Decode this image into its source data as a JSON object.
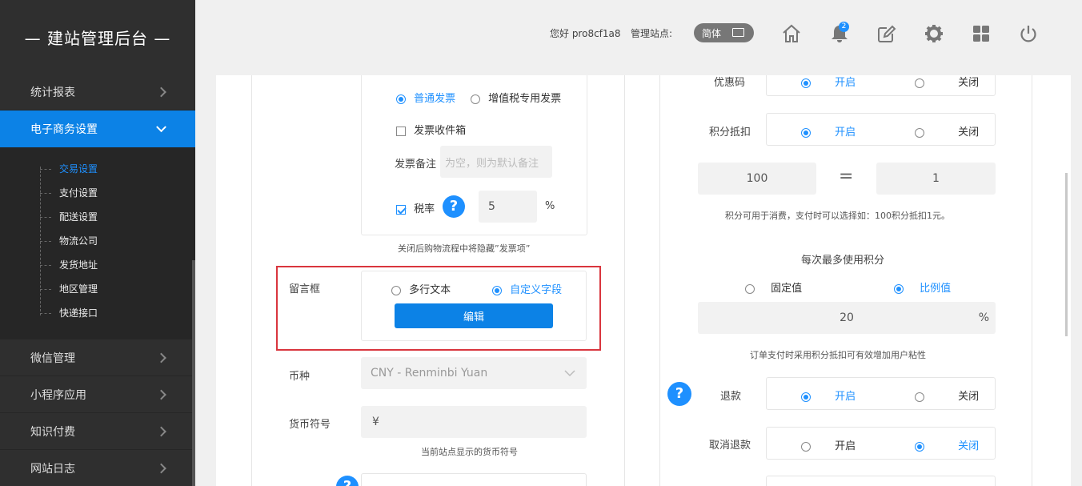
{
  "sidebar": {
    "title": "— 建站管理后台 —",
    "items": [
      {
        "label": "统计报表"
      },
      {
        "label": "电子商务设置"
      },
      {
        "label": "微信管理"
      },
      {
        "label": "小程序应用"
      },
      {
        "label": "知识付费"
      },
      {
        "label": "网站日志"
      }
    ],
    "sub_items": [
      "交易设置",
      "支付设置",
      "配送设置",
      "物流公司",
      "发货地址",
      "地区管理",
      "快递接口"
    ]
  },
  "header": {
    "greeting": "您好 pro8cf1a8",
    "site_label": "管理站点:",
    "lang": "简体",
    "notification_count": "2",
    "icons": [
      "home-icon",
      "bell-icon",
      "edit-icon",
      "gear-icon",
      "apps-icon",
      "power-icon"
    ]
  },
  "left": {
    "invoice": {
      "type_normal": "普通发票",
      "type_vat": "增值税专用发票",
      "inbox_label": "发票收件箱",
      "note_label": "发票备注",
      "note_placeholder": "为空，则为默认备注",
      "tax_label": "税率",
      "tax_value": "5",
      "tax_unit": "%",
      "hint": "关闭后购物流程中将隐藏”发票项”"
    },
    "message": {
      "label": "留言框",
      "opt_multiline": "多行文本",
      "opt_custom": "自定义字段",
      "edit_button": "编辑"
    },
    "currency": {
      "label": "币种",
      "value": "CNY - Renminbi Yuan"
    },
    "symbol": {
      "label": "货币符号",
      "value": "¥",
      "hint": "当前站点显示的货币符号"
    }
  },
  "right": {
    "coupon": {
      "label": "优惠码",
      "on": "开启",
      "off": "关闭"
    },
    "points": {
      "label": "积分抵扣",
      "on": "开启",
      "off": "关闭"
    },
    "ratio_left": "100",
    "ratio_eq": "=",
    "ratio_right": "1",
    "points_hint": "积分可用于消费，支付时可以选择如：100积分抵扣1元。",
    "max_title": "每次最多使用积分",
    "fixed": "固定值",
    "ratio": "比例值",
    "max_value": "20",
    "max_unit": "%",
    "max_hint": "订单支付时采用积分抵扣可有效增加用户粘性",
    "refund": {
      "label": "退款",
      "on": "开启",
      "off": "关闭"
    },
    "cancel_refund": {
      "label": "取消退款",
      "on": "开启",
      "off": "关闭"
    }
  },
  "colors": {
    "accent": "#0c82e6",
    "sidebar": "#2f2f2f",
    "highlight": "#d9363e"
  }
}
